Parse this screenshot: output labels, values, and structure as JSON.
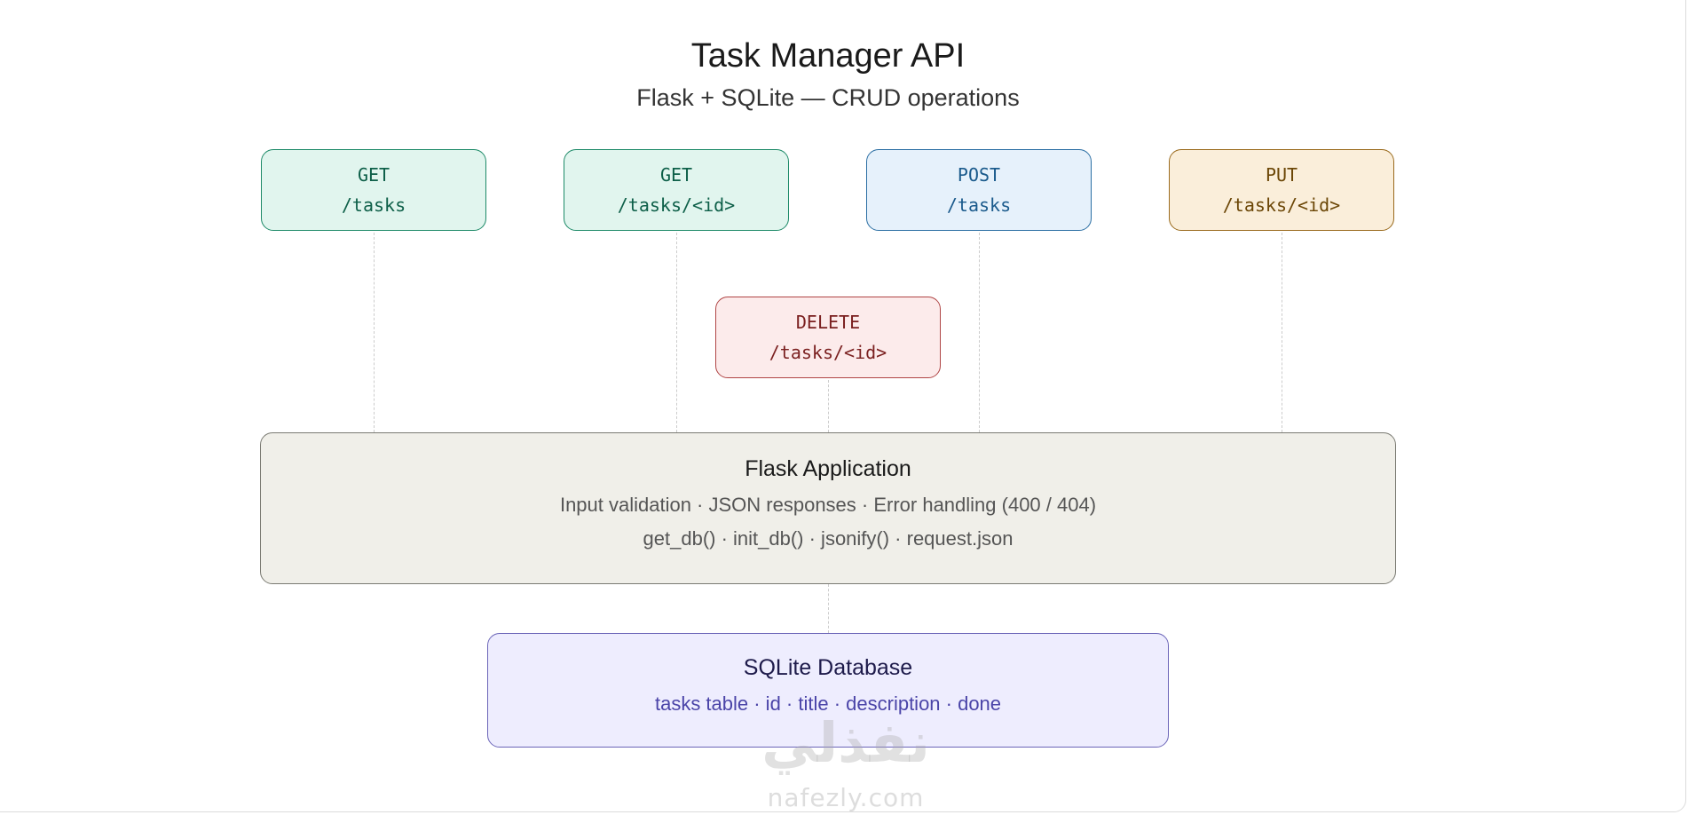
{
  "header": {
    "title": "Task Manager API",
    "subtitle": "Flask + SQLite — CRUD operations"
  },
  "endpoints": [
    {
      "method": "GET",
      "path": "/tasks",
      "color": "#1d8a68"
    },
    {
      "method": "GET",
      "path": "/tasks/<id>",
      "color": "#1d8a68"
    },
    {
      "method": "POST",
      "path": "/tasks",
      "color": "#2a6ea3"
    },
    {
      "method": "PUT",
      "path": "/tasks/<id>",
      "color": "#9a6a1c"
    },
    {
      "method": "DELETE",
      "path": "/tasks/<id>",
      "color": "#b04545"
    }
  ],
  "app": {
    "title": "Flask Application",
    "line1": "Input validation · JSON responses · Error handling (400 / 404)",
    "line2": "get_db() · init_db() · jsonify() · request.json"
  },
  "database": {
    "title": "SQLite Database",
    "line": "tasks table · id · title · description · done"
  },
  "watermark": {
    "arabic": "نفذلي",
    "latin": "nafezly.com"
  }
}
